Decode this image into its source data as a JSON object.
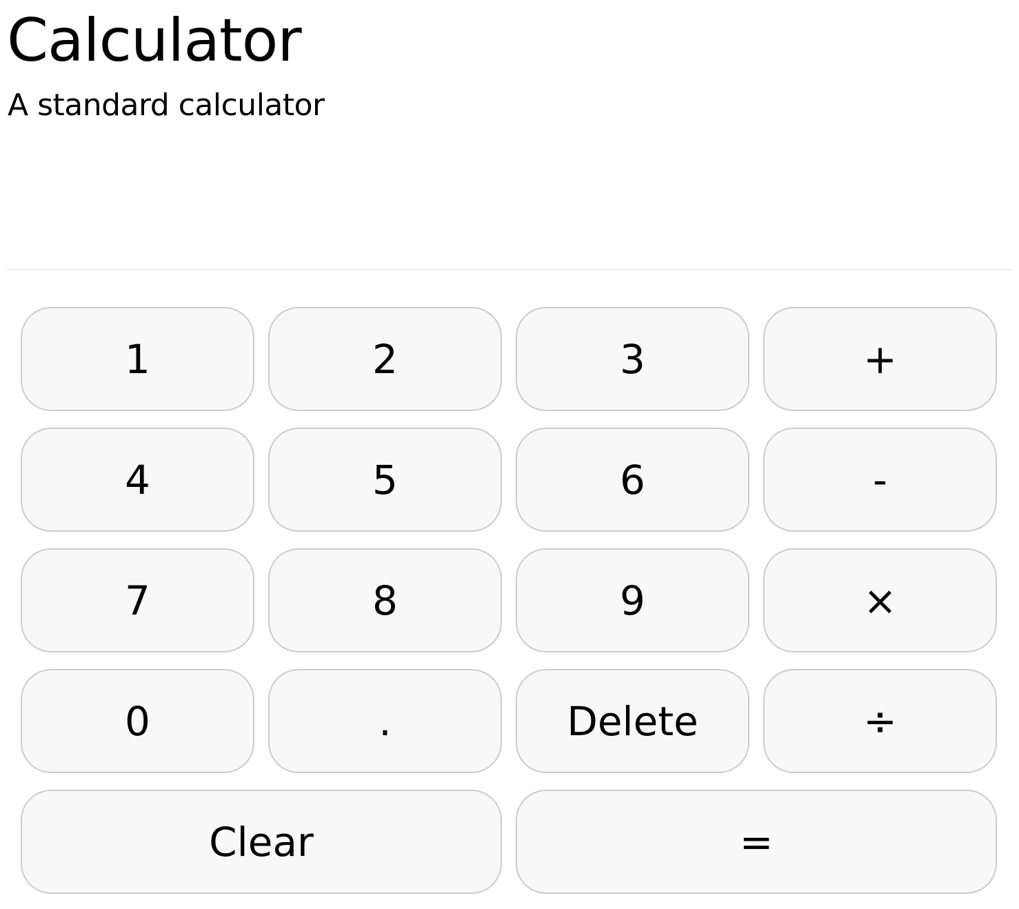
{
  "header": {
    "title": "Calculator",
    "subtitle": "A standard calculator"
  },
  "display": {
    "value": ""
  },
  "keypad": {
    "keys": [
      {
        "label": "1",
        "name": "key-1",
        "wide": false
      },
      {
        "label": "2",
        "name": "key-2",
        "wide": false
      },
      {
        "label": "3",
        "name": "key-3",
        "wide": false
      },
      {
        "label": "+",
        "name": "add-button",
        "wide": false
      },
      {
        "label": "4",
        "name": "key-4",
        "wide": false
      },
      {
        "label": "5",
        "name": "key-5",
        "wide": false
      },
      {
        "label": "6",
        "name": "key-6",
        "wide": false
      },
      {
        "label": "-",
        "name": "subtract-button",
        "wide": false
      },
      {
        "label": "7",
        "name": "key-7",
        "wide": false
      },
      {
        "label": "8",
        "name": "key-8",
        "wide": false
      },
      {
        "label": "9",
        "name": "key-9",
        "wide": false
      },
      {
        "label": "×",
        "name": "multiply-button",
        "wide": false
      },
      {
        "label": "0",
        "name": "key-0",
        "wide": false
      },
      {
        "label": ".",
        "name": "decimal-button",
        "wide": false
      },
      {
        "label": "Delete",
        "name": "delete-button",
        "wide": false
      },
      {
        "label": "÷",
        "name": "divide-button",
        "wide": false
      },
      {
        "label": "Clear",
        "name": "clear-button",
        "wide": true
      },
      {
        "label": "=",
        "name": "equals-button",
        "wide": true
      }
    ]
  },
  "colors": {
    "key_background": "#f8f8f8",
    "key_border": "#cccccc",
    "divider": "#eeeeee",
    "text": "#000000"
  }
}
